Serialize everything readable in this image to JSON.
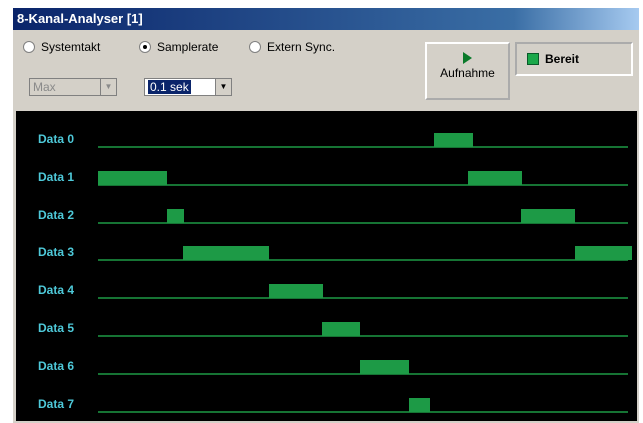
{
  "window": {
    "title": "8-Kanal-Analyser [1]"
  },
  "mode": {
    "options": [
      {
        "label": "Systemtakt",
        "selected": false
      },
      {
        "label": "Samplerate",
        "selected": true
      },
      {
        "label": "Extern Sync.",
        "selected": false
      }
    ],
    "clock_value": "Max",
    "samplerate_value": "0.1 sek"
  },
  "record_button": {
    "label": "Aufnahme"
  },
  "status": {
    "label": "Bereit",
    "color": "#1aa84a"
  },
  "trace_color": "#1d9a46",
  "channels": [
    {
      "label": "Data 0",
      "high": [
        [
          433,
          472
        ]
      ]
    },
    {
      "label": "Data 1",
      "high": [
        [
          97,
          166
        ],
        [
          467,
          521
        ]
      ]
    },
    {
      "label": "Data 2",
      "high": [
        [
          166,
          183
        ],
        [
          520,
          574
        ]
      ]
    },
    {
      "label": "Data 3",
      "high": [
        [
          182,
          268
        ],
        [
          574,
          631
        ]
      ]
    },
    {
      "label": "Data 4",
      "high": [
        [
          268,
          322
        ]
      ]
    },
    {
      "label": "Data 5",
      "high": [
        [
          321,
          359
        ]
      ]
    },
    {
      "label": "Data 6",
      "high": [
        [
          359,
          408
        ]
      ]
    },
    {
      "label": "Data 7",
      "high": [
        [
          408,
          429
        ]
      ]
    }
  ]
}
